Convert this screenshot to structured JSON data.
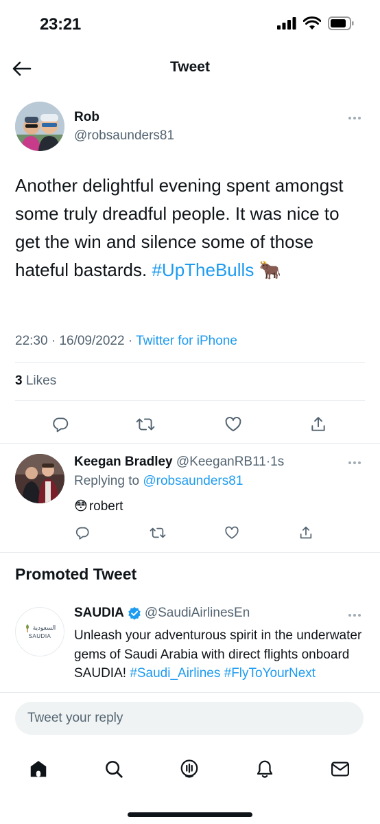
{
  "status_bar": {
    "time": "23:21"
  },
  "header": {
    "title": "Tweet"
  },
  "main_tweet": {
    "author_name": "Rob",
    "author_handle": "@robsaunders81",
    "text_before_hashtag": "Another delightful evening spent amongst some truly dreadful people. It was nice to get the win and silence some of those hateful bastards.",
    "hashtag": "#UpTheBulls",
    "emoji": "🐂",
    "time": "22:30",
    "date": "16/09/2022",
    "separator": "·",
    "source": "Twitter for iPhone",
    "likes_count": "3",
    "likes_label": "Likes"
  },
  "reply": {
    "author_name": "Keegan Bradley",
    "author_handle": "@KeeganRB11",
    "separator": "·",
    "time_ago": "1s",
    "replying_prefix": "Replying to",
    "replying_to": "@robsaunders81",
    "emoji": "😳",
    "text": "robert"
  },
  "promoted": {
    "section_title": "Promoted Tweet",
    "author_name": "SAUDIA",
    "author_handle": "@SaudiAirlinesEn",
    "avatar_logo_arabic": "السعودية",
    "avatar_logo_latin": "SAUDIA",
    "text": "Unleash your adventurous spirit in the underwater gems of Saudi Arabia with direct flights onboard SAUDIA!",
    "hashtag_1": "#Saudi_Airlines",
    "hashtag_2": "#FlyToYourNext"
  },
  "reply_box": {
    "placeholder": "Tweet your reply"
  },
  "icons": {
    "back": "arrow-left-icon",
    "more": "more-dots-icon",
    "reply": "reply-bubble-icon",
    "retweet": "retweet-icon",
    "like": "heart-icon",
    "share": "share-icon",
    "verified": "verified-badge-icon",
    "tabs": [
      "home-icon",
      "search-icon",
      "spaces-icon",
      "notifications-icon",
      "messages-icon"
    ]
  },
  "colors": {
    "accent": "#1d9bf0",
    "text": "#0f1419",
    "muted": "#536471",
    "divider": "#e6ebee"
  }
}
